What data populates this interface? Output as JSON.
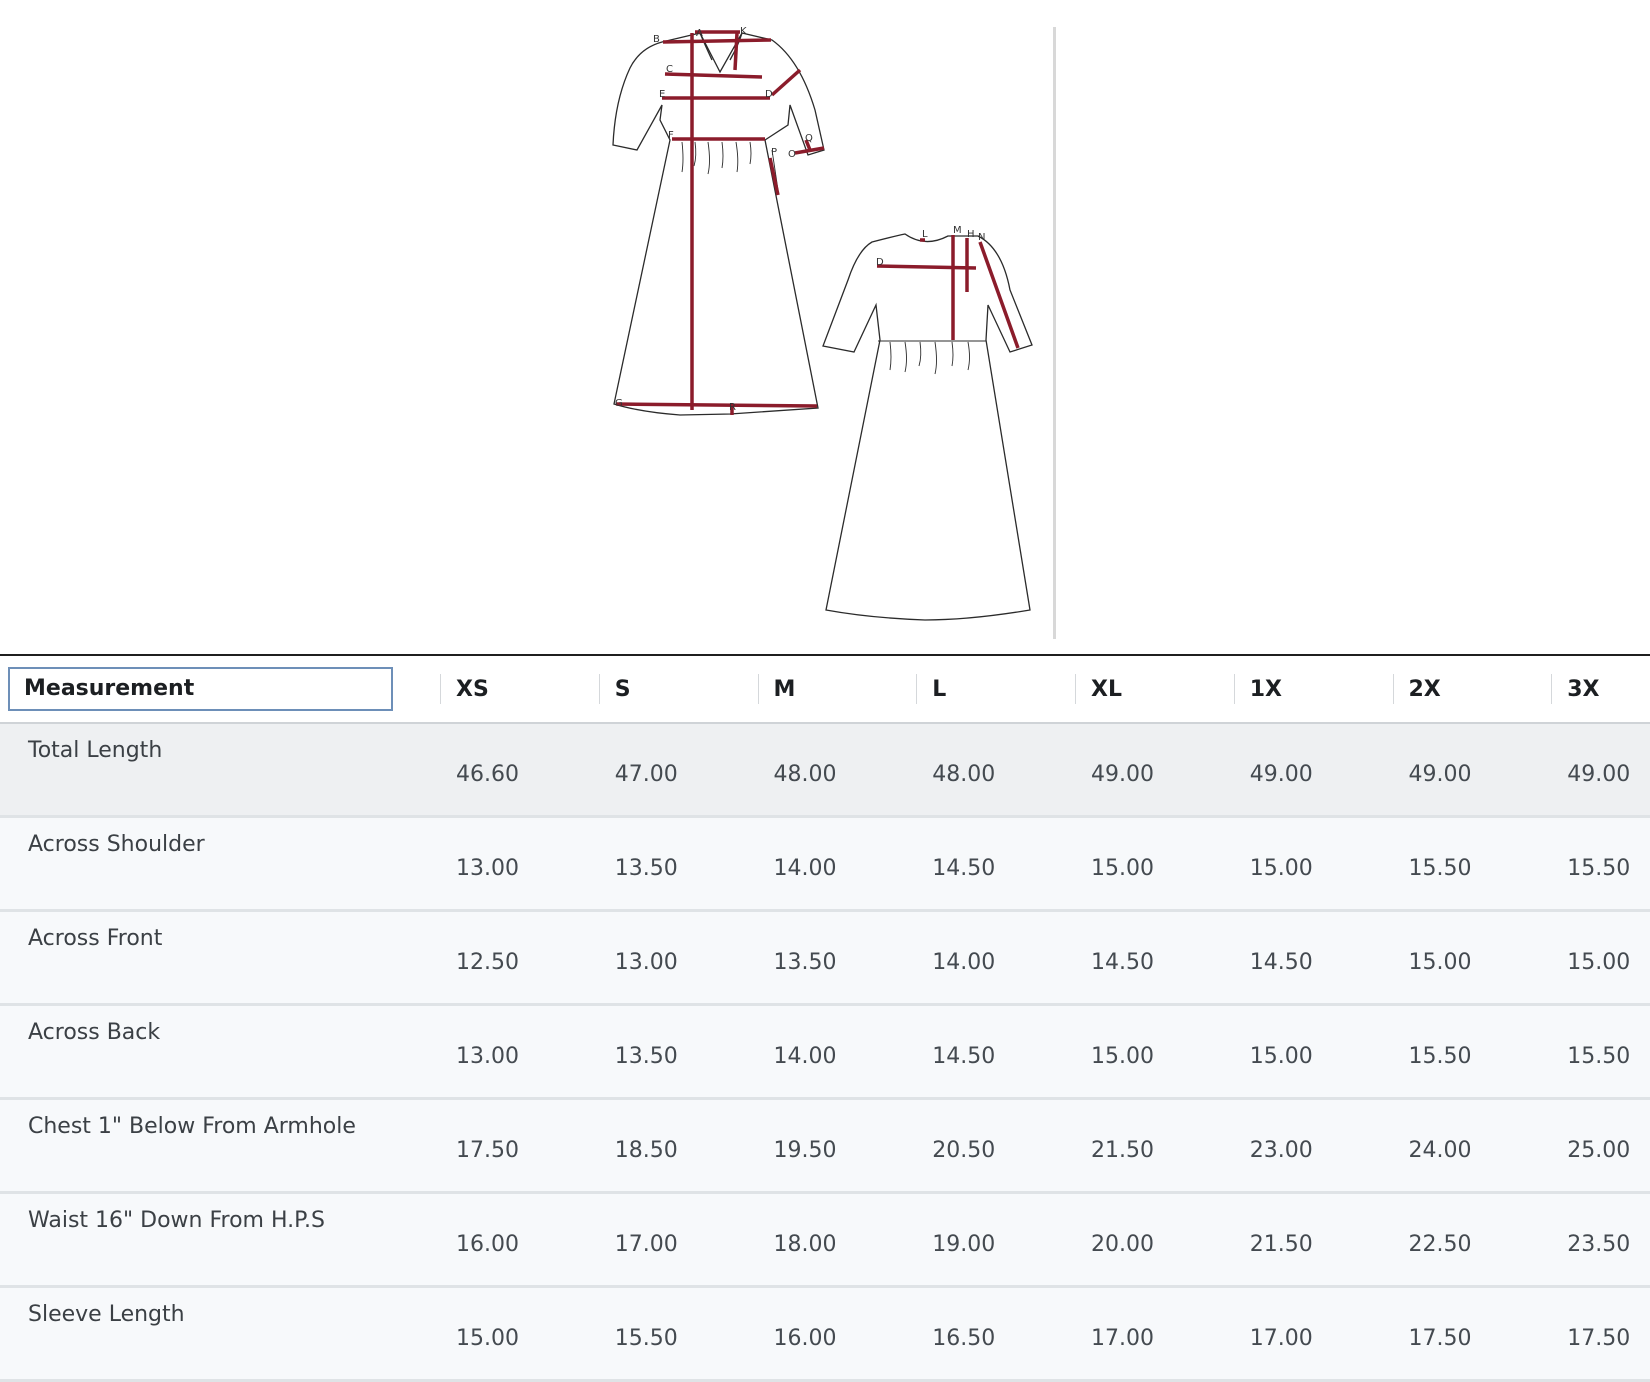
{
  "sketch": {
    "front_labels": [
      "A",
      "B",
      "K",
      "C",
      "D",
      "E",
      "F",
      "P",
      "O",
      "Q",
      "G",
      "R"
    ],
    "back_labels": [
      "L",
      "M",
      "H",
      "N",
      "D"
    ],
    "measure_color": "#8b1c2b"
  },
  "table": {
    "header": {
      "measurement": "Measurement",
      "sizes": [
        "XS",
        "S",
        "M",
        "L",
        "XL",
        "1X",
        "2X",
        "3X"
      ]
    },
    "rows": [
      {
        "label": "Total Length",
        "values": [
          "46.60",
          "47.00",
          "48.00",
          "48.00",
          "49.00",
          "49.00",
          "49.00",
          "49.00"
        ]
      },
      {
        "label": "Across Shoulder",
        "values": [
          "13.00",
          "13.50",
          "14.00",
          "14.50",
          "15.00",
          "15.00",
          "15.50",
          "15.50"
        ]
      },
      {
        "label": "Across Front",
        "values": [
          "12.50",
          "13.00",
          "13.50",
          "14.00",
          "14.50",
          "14.50",
          "15.00",
          "15.00"
        ]
      },
      {
        "label": "Across Back",
        "values": [
          "13.00",
          "13.50",
          "14.00",
          "14.50",
          "15.00",
          "15.00",
          "15.50",
          "15.50"
        ]
      },
      {
        "label": "Chest 1\" Below From Armhole",
        "values": [
          "17.50",
          "18.50",
          "19.50",
          "20.50",
          "21.50",
          "23.00",
          "24.00",
          "25.00"
        ]
      },
      {
        "label": "Waist 16\" Down From H.P.S",
        "values": [
          "16.00",
          "17.00",
          "18.00",
          "19.00",
          "20.00",
          "21.50",
          "22.50",
          "23.50"
        ]
      },
      {
        "label": "Sleeve Length",
        "values": [
          "15.00",
          "15.50",
          "16.00",
          "16.50",
          "17.00",
          "17.00",
          "17.50",
          "17.50"
        ]
      }
    ]
  }
}
